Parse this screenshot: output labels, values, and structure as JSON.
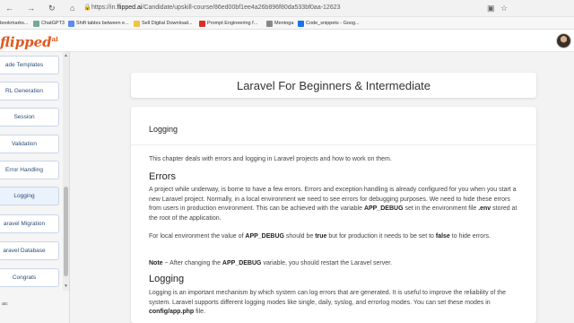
{
  "browser": {
    "url_prefix": "https://in.",
    "url_domain": "flipped.ai",
    "url_path": "/Candidate/upskill-course/86ed00bf1ee4a26b896f80da533bf0aa-12623",
    "bookmarks": [
      {
        "label": "bookmarks...",
        "color": "#f0c341"
      },
      {
        "label": "ChatGPT3",
        "color": "#74aa9c"
      },
      {
        "label": "Shift tables between e...",
        "color": "#5b8def"
      },
      {
        "label": "Sell Digital Download...",
        "color": "#f0c341"
      },
      {
        "label": "Prompt Engineering f...",
        "color": "#d93025"
      },
      {
        "label": "Mentoga",
        "color": "#888888"
      },
      {
        "label": "Code_snippets - Goog...",
        "color": "#1a73e8"
      }
    ]
  },
  "app": {
    "logo_text": "flipped",
    "logo_sup": "ai"
  },
  "sidebar": {
    "items": [
      {
        "label": "ade Templates",
        "active": false
      },
      {
        "label": "RL Generation",
        "active": false
      },
      {
        "label": "Session",
        "active": false
      },
      {
        "label": "Validation",
        "active": false
      },
      {
        "label": "Error Handling",
        "active": false
      },
      {
        "label": "Logging",
        "active": true
      },
      {
        "label": "aravel Migration",
        "active": false
      },
      {
        "label": "aravel Database",
        "active": false
      },
      {
        "label": "Congrats",
        "active": false
      }
    ],
    "footer": "as:"
  },
  "course": {
    "title": "Laravel For Beginners & Intermediate"
  },
  "lesson": {
    "section_title": "Logging",
    "intro": "This chapter deals with errors and logging in Laravel projects and how to work on them.",
    "errors_heading": "Errors",
    "errors_p1_a": "A project while underway, is borne to have a few errors. Errors and exception handling is already configured for you when you start a new Laravel project. Normally, in a local environment we need to see errors for debugging purposes. We need to hide these errors from users in production environment. This can be achieved with the variable ",
    "errors_p1_b": "APP_DEBUG",
    "errors_p1_c": " set in the environment file ",
    "errors_p1_d": ".env",
    "errors_p1_e": " stored at the root of the application.",
    "errors_p2_a": "For local environment the value of ",
    "errors_p2_b": "APP_DEBUG",
    "errors_p2_c": " should be ",
    "errors_p2_d": "true",
    "errors_p2_e": " but for production it needs to be set to ",
    "errors_p2_f": "false",
    "errors_p2_g": " to hide errors.",
    "note_a": "Note",
    "note_b": " − After changing the ",
    "note_c": "APP_DEBUG",
    "note_d": " variable, you should restart the Laravel server.",
    "logging_heading": "Logging",
    "logging_p_a": "Logging is an important mechanism by which system can log errors that are generated. It is useful to improve the reliability of the system. Laravel supports different logging modes like single, daily, syslog, and errorlog modes. You can set these modes in ",
    "logging_p_b": "config/app.php",
    "logging_p_c": " file."
  }
}
